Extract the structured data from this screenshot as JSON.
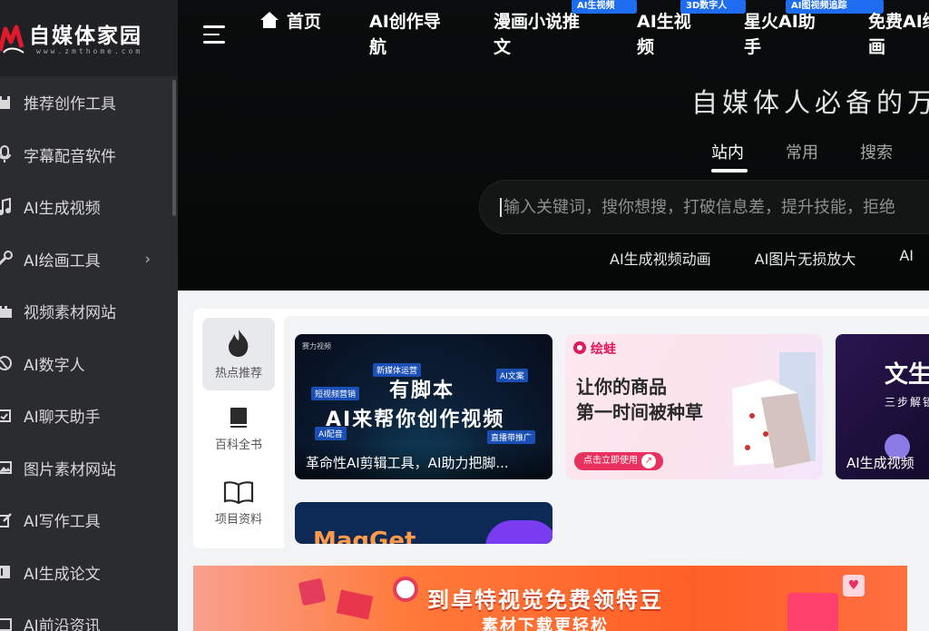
{
  "brand": {
    "name": "自媒体家园",
    "domain": "www.zmthome.com",
    "accent": "#e0192c"
  },
  "sidebar": {
    "items": [
      {
        "label": "推荐创作工具",
        "icon": "bookmark-icon"
      },
      {
        "label": "字幕配音软件",
        "icon": "microphone-icon"
      },
      {
        "label": "AI生成视频",
        "icon": "music-note-icon"
      },
      {
        "label": "AI绘画工具",
        "icon": "brush-icon",
        "has_submenu": true,
        "chevron": "›"
      },
      {
        "label": "视频素材网站",
        "icon": "film-icon"
      },
      {
        "label": "AI数字人",
        "icon": "globe-icon"
      },
      {
        "label": "AI聊天助手",
        "icon": "chat-icon"
      },
      {
        "label": "图片素材网站",
        "icon": "image-icon"
      },
      {
        "label": "AI写作工具",
        "icon": "edit-icon"
      },
      {
        "label": "AI生成论文",
        "icon": "document-icon"
      },
      {
        "label": "AI前沿资讯",
        "icon": "news-icon"
      }
    ]
  },
  "nav": {
    "items": [
      {
        "label": "首页",
        "badge": ""
      },
      {
        "label": "AI创作导航",
        "badge": ""
      },
      {
        "label": "漫画小说推文",
        "badge": "AI生视频"
      },
      {
        "label": "AI生视频",
        "badge": "3D数字人"
      },
      {
        "label": "星火AI助手",
        "badge": "AI图视频追踪"
      },
      {
        "label": "免费AI绘画",
        "badge": ""
      }
    ]
  },
  "hero": {
    "slogan": "自媒体人必备的万",
    "search_tabs": [
      "站内",
      "常用",
      "搜索"
    ],
    "active_tab": "站内",
    "search_placeholder": "输入关键词，搜你想搜，打破信息差，提升技能，拒绝",
    "hot_links": [
      "AI生成视频动画",
      "AI图片无损放大",
      "AI"
    ]
  },
  "panel": {
    "tabs": [
      {
        "label": "热点推荐",
        "icon": "flame-icon",
        "active": true
      },
      {
        "label": "百科全书",
        "icon": "book-icon",
        "active": false
      },
      {
        "label": "项目资料",
        "icon": "open-book-icon",
        "active": false
      }
    ],
    "cards": [
      {
        "caption": "革命性AI剪辑工具，AI助力把脚...",
        "brand": "赛力视频",
        "headline1": "有脚本",
        "headline2": "AI来帮你创作视频",
        "tags": [
          "新媒体运营",
          "AI文案",
          "短视频营销",
          "AI配音",
          "直播带推广"
        ]
      },
      {
        "caption": "",
        "brand": "绘蛙",
        "headline1": "让你的商品",
        "headline2": "第一时间被种草",
        "button": "点击立即使用"
      },
      {
        "caption": "AI生成视频",
        "headline1": "文生",
        "headline2": "三步解锁"
      },
      {
        "caption": "",
        "partial_text": "MagGet"
      }
    ]
  },
  "banner": {
    "line1": "到卓特视觉免费领特豆",
    "line2": "素材下载更轻松"
  }
}
